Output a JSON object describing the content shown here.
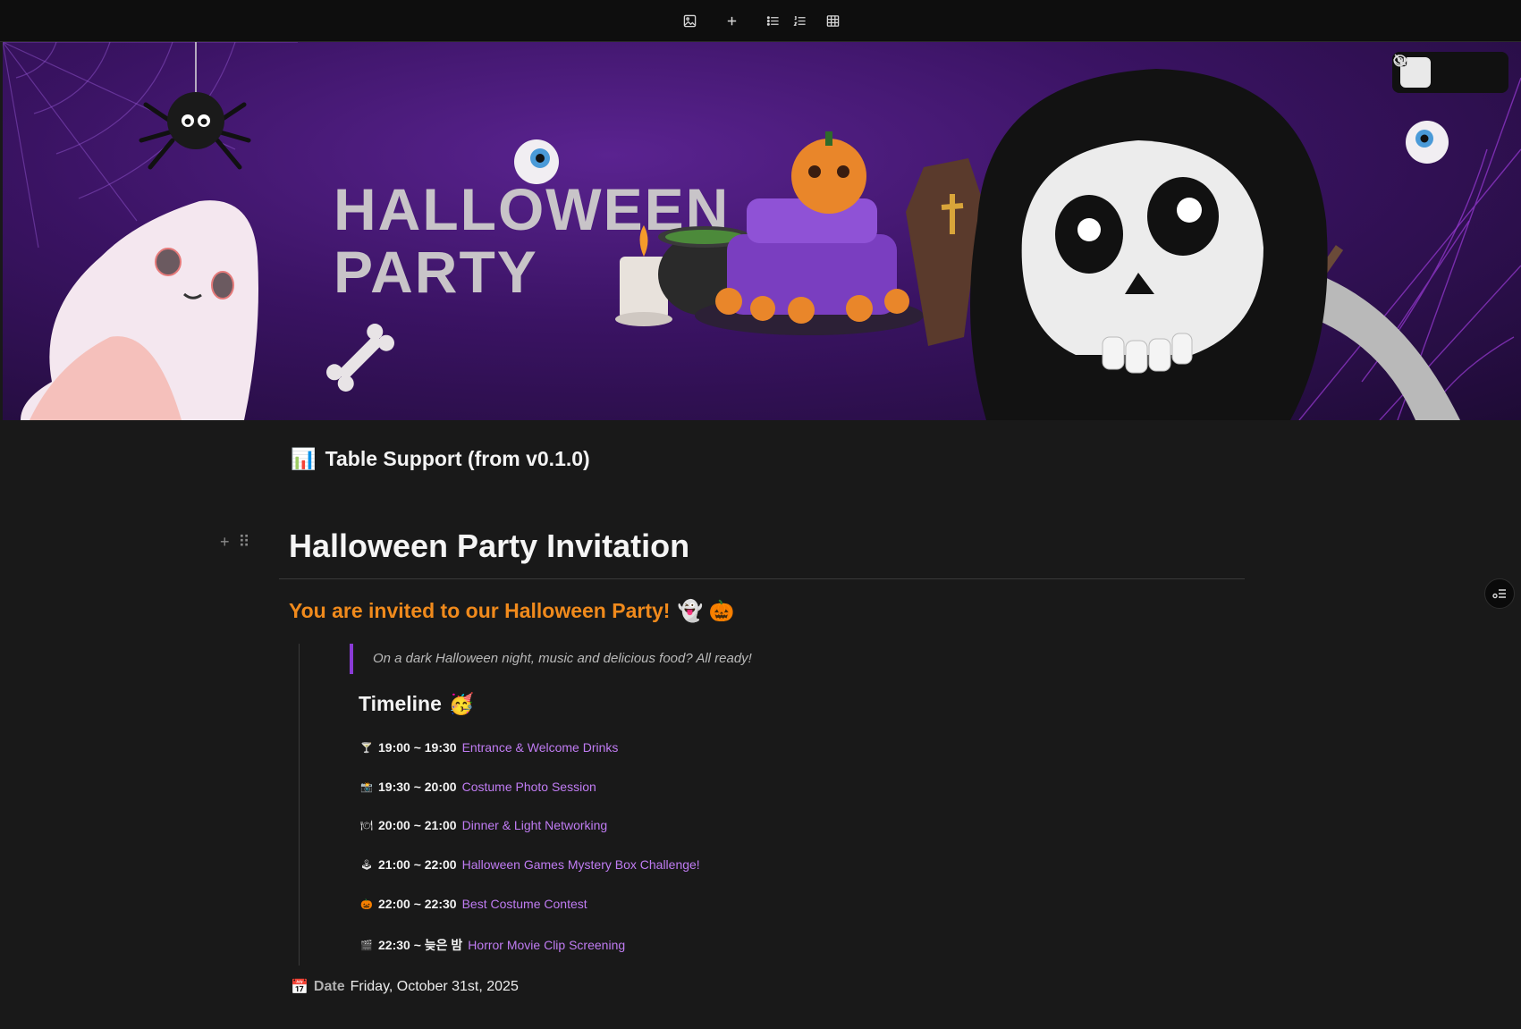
{
  "toolbar": {
    "buttons": [
      {
        "name": "image-icon"
      },
      {
        "name": "plus-icon"
      },
      {
        "name": "bulleted-list-icon"
      },
      {
        "name": "numbered-list-icon"
      },
      {
        "name": "table-icon"
      }
    ]
  },
  "banner": {
    "title_line1": "HALLOWEEN",
    "title_line2": "PARTY",
    "accent": "#5a2390"
  },
  "view_controls": {
    "buttons": [
      {
        "name": "notion-icon",
        "active": true
      },
      {
        "name": "eye-off-icon",
        "active": false
      },
      {
        "name": "moon-icon",
        "active": false
      }
    ]
  },
  "page": {
    "title_emoji": "📊",
    "title": "Table Support (from v0.1.0)",
    "heading": "Halloween Party Invitation",
    "subheading": "You are invited to our Halloween Party!",
    "subheading_emojis": "👻 🎃",
    "quote": "On a dark Halloween night, music and delicious food? All ready!",
    "timeline_title": "Timeline",
    "timeline_emoji": "🥳",
    "timeline": [
      {
        "icon": "🍸",
        "time": "19:00 ~ 19:30",
        "desc": "Entrance & Welcome Drinks"
      },
      {
        "icon": "📸",
        "time": "19:30 ~ 20:00",
        "desc": "Costume Photo Session"
      },
      {
        "icon": "🍽",
        "time": "20:00 ~ 21:00",
        "desc": "Dinner & Light Networking"
      },
      {
        "icon": "🕹",
        "time": "21:00 ~ 22:00",
        "desc": "Halloween Games Mystery Box Challenge!"
      },
      {
        "icon": "🎃",
        "time": "22:00 ~ 22:30",
        "desc": "Best Costume Contest"
      },
      {
        "icon": "🎬",
        "time": "22:30 ~ 늦은 밤",
        "desc": "Horror Movie Clip Screening"
      }
    ],
    "date_icon": "📅",
    "date_label": "Date",
    "date_value": "Friday, October 31st, 2025"
  },
  "colors": {
    "background": "#191919",
    "heading_orange": "#f08a1c",
    "link_purple": "#c07cf3",
    "quote_bar": "#8a3bd6"
  }
}
